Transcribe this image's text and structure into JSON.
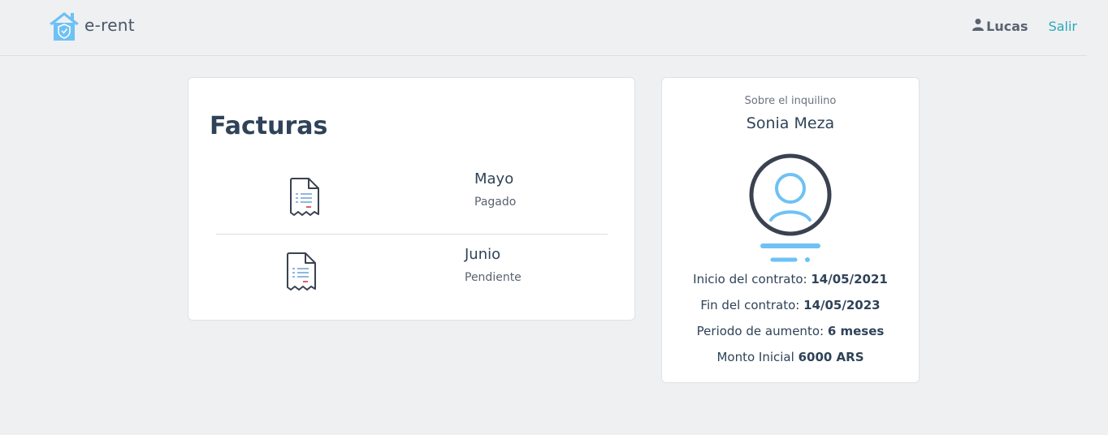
{
  "brand": {
    "name": "e-rent",
    "logo_icon": "house-shield-icon",
    "accent": "#6ec1f5"
  },
  "nav": {
    "user_icon": "user-icon",
    "user_name": "Lucas",
    "logout_label": "Salir",
    "logout_color": "#2aa8b8"
  },
  "invoices": {
    "title": "Facturas",
    "items": [
      {
        "month": "Mayo",
        "status": "Pagado",
        "icon": "receipt-icon"
      },
      {
        "month": "Junio",
        "status": "Pendiente",
        "icon": "receipt-icon"
      }
    ]
  },
  "tenant": {
    "caption": "Sobre el inquilino",
    "name": "Sonia Meza",
    "avatar_icon": "user-avatar-icon",
    "contract_start_label": "Inicio del contrato:",
    "contract_start_value": "14/05/2021",
    "contract_end_label": "Fin del contrato:",
    "contract_end_value": "14/05/2023",
    "increase_period_label": "Periodo de aumento:",
    "increase_period_value": "6 meses",
    "initial_amount_label": "Monto Inicial",
    "initial_amount_value": "6000 ARS"
  }
}
